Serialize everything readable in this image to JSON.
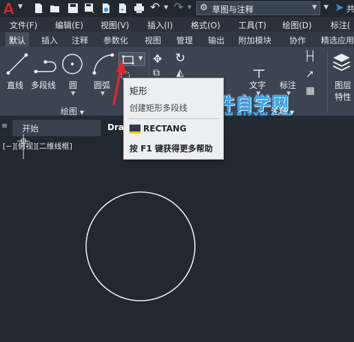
{
  "quick_access": {
    "workspace": "草图与注释"
  },
  "menu": {
    "items": [
      "文件(F)",
      "编辑(E)",
      "视图(V)",
      "插入(I)",
      "格式(O)",
      "工具(T)",
      "绘图(D)",
      "标注("
    ]
  },
  "ribbon_tabs": {
    "items": [
      "默认",
      "插入",
      "注释",
      "参数化",
      "视图",
      "管理",
      "输出",
      "附加模块",
      "协作",
      "精选应用"
    ]
  },
  "ribbon": {
    "draw_tools": {
      "line": "直线",
      "polyline": "多段线",
      "circle": "圆",
      "arc": "圆弧"
    },
    "draw_panel": "绘图",
    "annotation_tools": {
      "text": "文字",
      "dimension": "标注"
    },
    "annotation_panel": "注释",
    "layers": {
      "line1": "图层",
      "line2": "特性"
    }
  },
  "doc_tabs": {
    "start": "开始",
    "drawing": "Dra"
  },
  "canvas": {
    "viewport_label": "[−][俯视][二维线框]"
  },
  "tooltip": {
    "title": "矩形",
    "description": "创建矩形多段线",
    "command": "RECTANG",
    "help": "按 F1 键获得更多帮助"
  },
  "watermark": {
    "main": "软件自学网",
    "sub": "WWW.RJZXW.COM"
  },
  "colors": {
    "canvas": "#212830",
    "ribbon": "#3b4450",
    "accent_red": "#e8242b",
    "watermark": "#2aa8ff"
  }
}
